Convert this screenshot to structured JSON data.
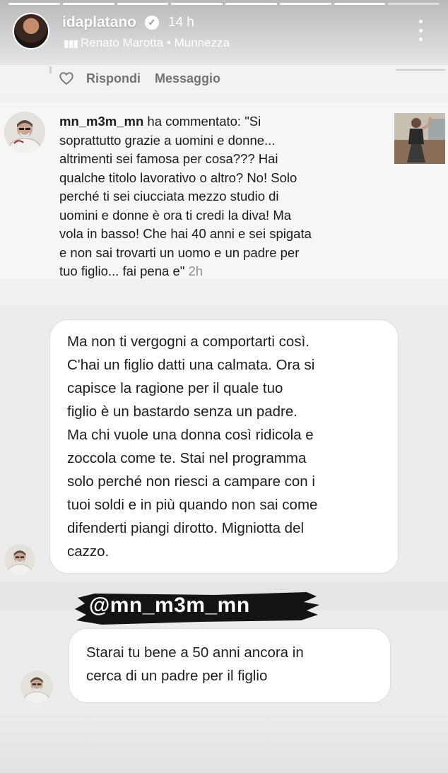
{
  "story": {
    "username": "idaplatano",
    "verified_mark": "✓",
    "time": "14 h",
    "music": "Renato Marotta • Munnezza",
    "progress_segments": 8,
    "active_segments": 7
  },
  "actions": {
    "reply_label": "Rispondi",
    "message_label": "Messaggio"
  },
  "comment": {
    "username": "mn_m3m_mn",
    "body": " ha commentato: \"Si\nsoprattutto grazie a uomini e donne...\naltrimenti sei famosa per cosa??? Hai\nqualche titolo lavorativo o altro? No! Solo\nperché  ti sei ciucciata mezzo studio di\nuomini e donne è ora ti credi la diva! Ma\nvola in basso! Che hai 40 anni e sei spigata\ne non sai trovarti un uomo e un padre per\ntuo figlio... fai pena e\" ",
    "time": "2h"
  },
  "dm": {
    "message1": "Ma non ti vergogni a comportarti così.\nC'hai un figlio datti una calmata. Ora si\ncapisce la ragione per il quale tuo\nfiglio è un bastardo senza un padre.\nMa chi vuole una donna così ridicola e\nzoccola come te. Stai nel programma\nsolo perché non riesci a campare con i\ntuoi soldi e in più quando non sai come\ndifenderti piangi dirotto. Migniotta del\ncazzo.",
    "mention": "@mn_m3m_mn",
    "message2": "Starai tu bene a 50 anni ancora in\ncerca di un padre per il figlio"
  },
  "icons": {
    "heart": "heart-icon",
    "music": "music-bars-icon",
    "more": "kebab-icon"
  },
  "colors": {
    "muted_text": "#737373",
    "timestamp": "#8e8e8e",
    "mention_brush": "#141414"
  }
}
